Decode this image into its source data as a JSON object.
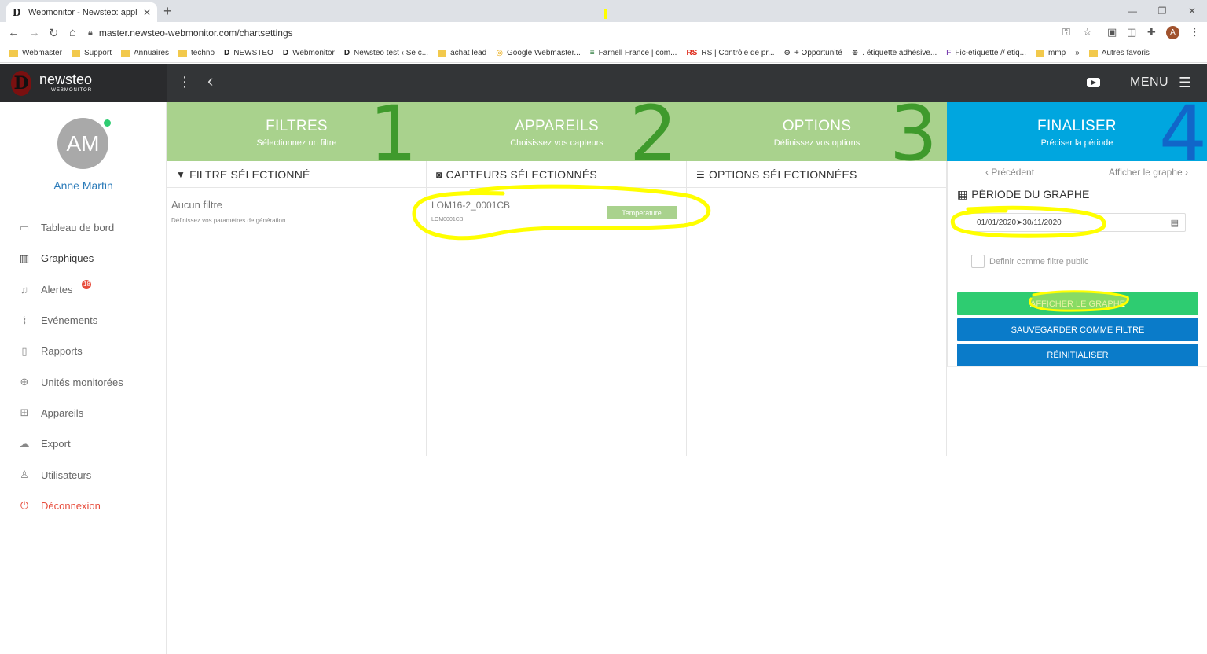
{
  "browser": {
    "tab_title": "Webmonitor - Newsteo: application",
    "tab_favicon": "D",
    "url": "master.newsteo-webmonitor.com/chartsettings",
    "profile_initial": "A",
    "bookmarks": [
      {
        "label": "Webmaster",
        "icon": "folder"
      },
      {
        "label": "Support",
        "icon": "folder"
      },
      {
        "label": "Annuaires",
        "icon": "folder"
      },
      {
        "label": "techno",
        "icon": "folder"
      },
      {
        "label": "NEWSTEO",
        "icon": "newsteo"
      },
      {
        "label": "Webmonitor",
        "icon": "newsteo"
      },
      {
        "label": "Newsteo test ‹ Se c...",
        "icon": "newsteo"
      },
      {
        "label": "achat lead",
        "icon": "folder"
      },
      {
        "label": "Google Webmaster...",
        "icon": "google"
      },
      {
        "label": "Farnell France | com...",
        "icon": "farnell"
      },
      {
        "label": "RS | Contrôle de pr...",
        "icon": "rs"
      },
      {
        "label": "+ Opportunité",
        "icon": "globe"
      },
      {
        "label": ". étiquette adhésive...",
        "icon": "globe"
      },
      {
        "label": "Fic-etiquette // etiq...",
        "icon": "fic"
      },
      {
        "label": "mmp",
        "icon": "folder"
      },
      {
        "label": "»",
        "icon": "none"
      },
      {
        "label": "Autres favoris",
        "icon": "folder"
      }
    ]
  },
  "app": {
    "logo_name": "newsteo",
    "logo_sub": "WEBMONITOR",
    "menu_label": "MENU"
  },
  "user": {
    "initials": "AM",
    "name": "Anne Martin"
  },
  "nav": [
    {
      "label": "Tableau de bord",
      "icon": "monitor-icon",
      "glyph": "▭"
    },
    {
      "label": "Graphiques",
      "icon": "bar-chart-icon",
      "glyph": "▥"
    },
    {
      "label": "Alertes",
      "icon": "bell-icon",
      "glyph": "♫",
      "badge": "18"
    },
    {
      "label": "Evénements",
      "icon": "paperclip-icon",
      "glyph": "⌇"
    },
    {
      "label": "Rapports",
      "icon": "book-icon",
      "glyph": "▯"
    },
    {
      "label": "Unités monitorées",
      "icon": "crosshair-icon",
      "glyph": "⊕"
    },
    {
      "label": "Appareils",
      "icon": "grid-icon",
      "glyph": "⊞"
    },
    {
      "label": "Export",
      "icon": "cloud-icon",
      "glyph": "☁"
    },
    {
      "label": "Utilisateurs",
      "icon": "user-icon",
      "glyph": "♙"
    },
    {
      "label": "Déconnexion",
      "icon": "power-icon",
      "glyph": "⏻"
    }
  ],
  "steps": [
    {
      "title": "FILTRES",
      "subtitle": "Sélectionnez un filtre",
      "number": "1"
    },
    {
      "title": "APPAREILS",
      "subtitle": "Choisissez vos capteurs",
      "number": "2"
    },
    {
      "title": "OPTIONS",
      "subtitle": "Définissez vos options",
      "number": "3"
    },
    {
      "title": "FINALISER",
      "subtitle": "Préciser la période",
      "number": "4"
    }
  ],
  "columns": {
    "filter": {
      "heading": "FILTRE SÉLECTIONNÉ",
      "name": "Aucun filtre",
      "description": "Définissez vos paramètres de génération"
    },
    "sensors": {
      "heading": "CAPTEURS SÉLECTIONNÉS",
      "sensor_name": "LOM16-2_0001CB",
      "sensor_id": "LOM0001CB",
      "sensor_tag": "Temperature"
    },
    "options": {
      "heading": "OPTIONS SÉLECTIONNÉES"
    }
  },
  "finalize": {
    "prev_label": "Précédent",
    "next_label": "Afficher le graphe",
    "period_title": "PÉRIODE DU GRAPHE",
    "date_range": "01/01/2020➤30/11/2020",
    "public_filter_label": "Definir comme filtre public",
    "btn_show": "AFFICHER LE GRAPHE",
    "btn_save": "SAUVEGARDER COMME FILTRE",
    "btn_reset": "RÉINITIALISER"
  },
  "colors": {
    "step_green": "#a9d28d",
    "step_blue": "#00a6df",
    "btn_green": "#2ecc71",
    "btn_blue": "#0a7bc9",
    "annotation_yellow": "#ffff00"
  }
}
